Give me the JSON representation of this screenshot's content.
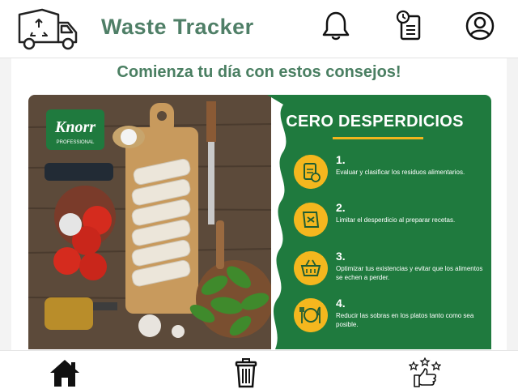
{
  "header": {
    "title": "Waste Tracker",
    "icons": {
      "logo": "recycling-truck-icon",
      "notifications": "bell-icon",
      "tasks": "clipboard-clock-icon",
      "profile": "user-icon"
    }
  },
  "main": {
    "heading": "Comienza tu día con estos consejos!",
    "banner": {
      "brand": "Knorr",
      "brand_sub": "PROFESSIONAL",
      "title": "CERO DESPERDICIOS",
      "accent_color": "#f4b71e",
      "panel_color": "#1f7a3e",
      "steps": [
        {
          "num": "1.",
          "text": "Evaluar y clasificar los residuos alimentarios."
        },
        {
          "num": "2.",
          "text": "Limitar el desperdicio al preparar recetas."
        },
        {
          "num": "3.",
          "text": "Optimizar tus existencias y evitar que los alimentos se echen a perder."
        },
        {
          "num": "4.",
          "text": "Reducir las sobras en los platos tanto como sea posible."
        }
      ]
    }
  },
  "bottom_nav": {
    "items": [
      {
        "icon": "home-icon"
      },
      {
        "icon": "trash-icon"
      },
      {
        "icon": "thumbs-up-stars-icon"
      }
    ]
  }
}
